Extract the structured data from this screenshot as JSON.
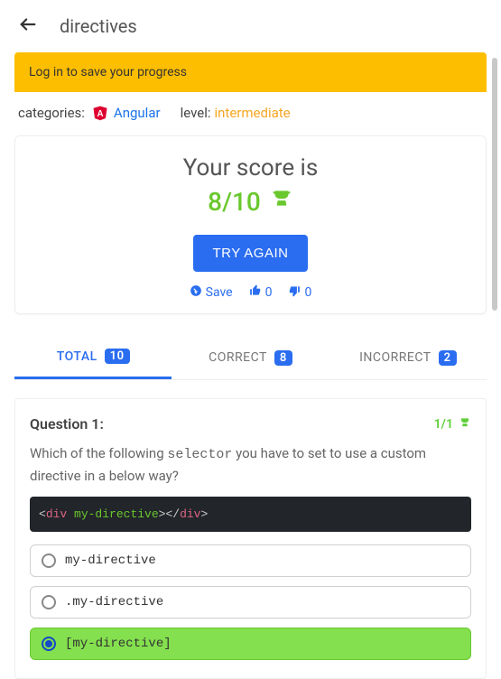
{
  "header": {
    "title": "directives"
  },
  "banner": "Log in to save your progress",
  "meta": {
    "categories_prefix": "categories:",
    "category_name": "Angular",
    "level_prefix": "level:",
    "level_value": "intermediate"
  },
  "score": {
    "title": "Your score is",
    "value": "8/10",
    "try_again": "TRY AGAIN",
    "save": "Save",
    "likes": "0",
    "dislikes": "0"
  },
  "tabs": {
    "total": {
      "label": "TOTAL",
      "count": "10"
    },
    "correct": {
      "label": "CORRECT",
      "count": "8"
    },
    "incorrect": {
      "label": "INCORRECT",
      "count": "2"
    }
  },
  "question": {
    "heading": "Question 1:",
    "points": "1/1",
    "text_a": "Which of the following ",
    "text_mono": "selector",
    "text_b": " you have to set to use a custom directive in a below way?",
    "code": {
      "p1": "<",
      "tag1": "div",
      "sp": " ",
      "attr": "my-directive",
      "p2": ">",
      "p3": "</",
      "tag2": "div",
      "p4": ">"
    },
    "options": [
      {
        "label": "my-directive",
        "selected": false
      },
      {
        "label": ".my-directive",
        "selected": false
      },
      {
        "label": "[my-directive]",
        "selected": true
      }
    ]
  }
}
